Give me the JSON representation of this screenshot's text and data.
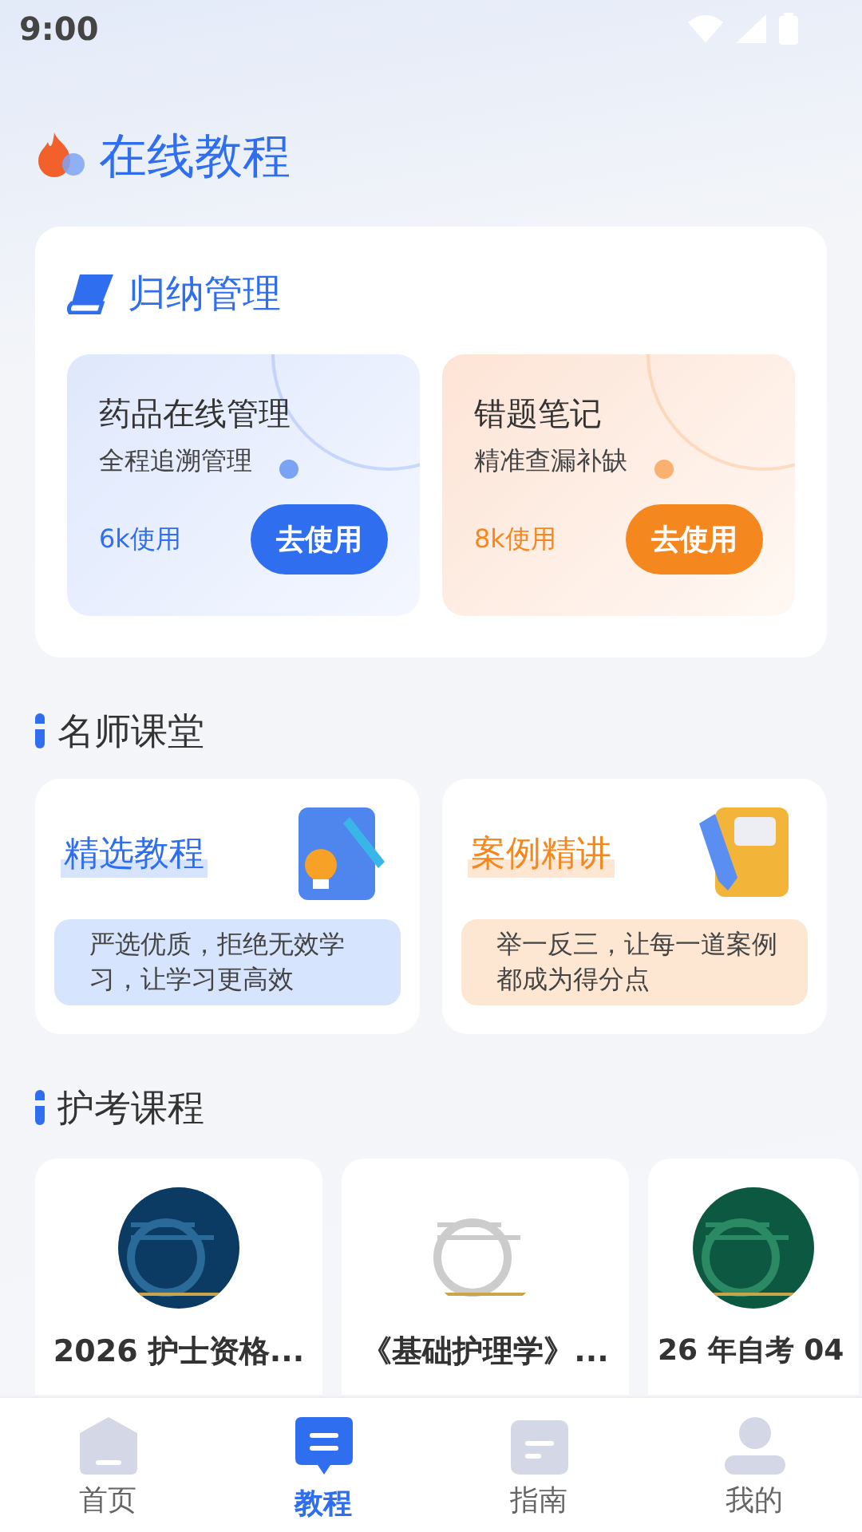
{
  "status_bar": {
    "time": "9:00"
  },
  "page_title": "在线教程",
  "summary_card": {
    "title": "归纳管理",
    "tools": [
      {
        "name": "药品在线管理",
        "subtitle": "全程追溯管理",
        "usage": "6k使用",
        "button": "去使用",
        "color": "#2f6fef"
      },
      {
        "name": "错题笔记",
        "subtitle": "精准查漏补缺",
        "usage": "8k使用",
        "button": "去使用",
        "color": "#f5871f"
      }
    ]
  },
  "teachers_section": {
    "title": "名师课堂",
    "cards": [
      {
        "title": "精选教程",
        "description": "严选优质，拒绝无效学习，让学习更高效",
        "color": "#2f6fef"
      },
      {
        "title": "案例精讲",
        "description": "举一反三，让每一道案例都成为得分点",
        "color": "#f5871f"
      }
    ]
  },
  "courses_section": {
    "title": "护考课程",
    "courses": [
      {
        "title": "2026 护士资格...",
        "kind": "picture"
      },
      {
        "title": "《基础护理学》...",
        "kind": "picture"
      },
      {
        "title": "26 年自考 04",
        "kind": "picture"
      }
    ]
  },
  "tab_bar": [
    {
      "label": "首页",
      "selected": false
    },
    {
      "label": "教程",
      "selected": true
    },
    {
      "label": "指南",
      "selected": false
    },
    {
      "label": "我的",
      "selected": false
    }
  ]
}
